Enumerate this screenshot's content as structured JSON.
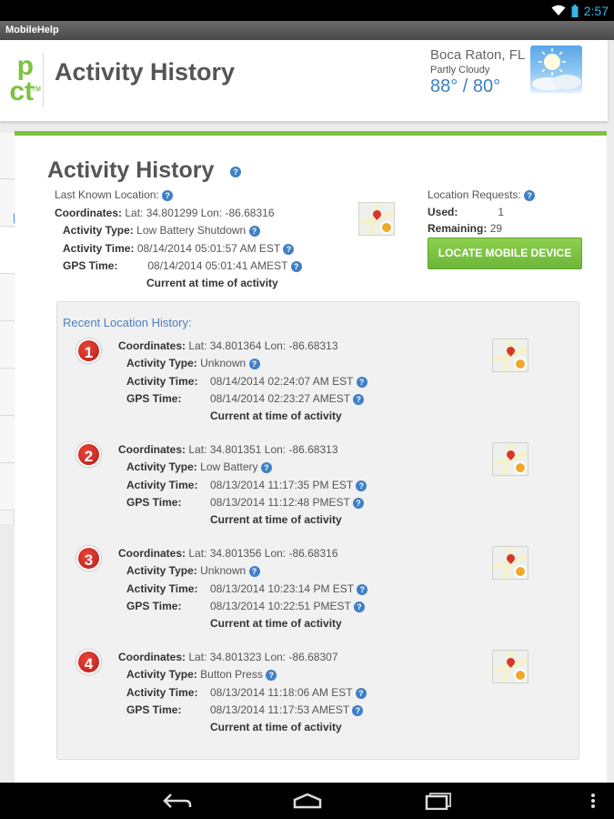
{
  "status": {
    "time": "2:57"
  },
  "app": {
    "name": "MobileHelp"
  },
  "header": {
    "logo_line1": "p",
    "logo_line2": "ct",
    "logo_tm": "TM",
    "title": "Activity History",
    "weather": {
      "city": "Boca Raton, FL",
      "condition": "Partly Cloudy",
      "temp": "88° / 80°"
    }
  },
  "page": {
    "title": "Activity History",
    "help_glyph": "?",
    "last_known": {
      "heading": "Last Known Location:",
      "coordinates_label": "Coordinates:",
      "coordinates_value": "Lat: 34.801299  Lon: -86.68316",
      "activity_type_label": "Activity Type:",
      "activity_type_value": "Low Battery Shutdown",
      "activity_time_label": "Activity Time:",
      "activity_time_value": "08/14/2014 05:01:57 AM EST",
      "gps_time_label": "GPS Time:",
      "gps_time_value": "08/14/2014 05:01:41 AMEST",
      "note": "Current at time of activity"
    },
    "requests": {
      "heading": "Location Requests:",
      "used_label": "Used:",
      "used_value": "1",
      "remaining_label": "Remaining:",
      "remaining_value": "29",
      "button": "LOCATE MOBILE DEVICE"
    },
    "history": {
      "heading": "Recent Location History:",
      "labels": {
        "coordinates": "Coordinates:",
        "activity_type": "Activity Type:",
        "activity_time": "Activity Time:",
        "gps_time": "GPS Time:"
      },
      "entries": [
        {
          "num": "1",
          "coordinates": "Lat: 34.801364  Lon: -86.68313",
          "activity_type": "Unknown",
          "activity_time": "08/14/2014 02:24:07 AM EST",
          "gps_time": "08/14/2014 02:23:27 AMEST",
          "note": "Current at time of activity"
        },
        {
          "num": "2",
          "coordinates": "Lat: 34.801351  Lon: -86.68313",
          "activity_type": "Low Battery",
          "activity_time": "08/13/2014 11:17:35 PM EST",
          "gps_time": "08/13/2014 11:12:48 PMEST",
          "note": "Current at time of activity"
        },
        {
          "num": "3",
          "coordinates": "Lat: 34.801356  Lon: -86.68316",
          "activity_type": "Unknown",
          "activity_time": "08/13/2014 10:23:14 PM EST",
          "gps_time": "08/13/2014 10:22:51 PMEST",
          "note": "Current at time of activity"
        },
        {
          "num": "4",
          "coordinates": "Lat: 34.801323  Lon: -86.68307",
          "activity_type": "Button Press",
          "activity_time": "08/13/2014 11:18:06 AM EST",
          "gps_time": "08/13/2014 11:17:53 AMEST",
          "note": "Current at time of activity"
        }
      ]
    }
  },
  "colors": {
    "accent_green": "#7cc242",
    "link_blue": "#4a7fc0",
    "badge_red": "#d0271e"
  }
}
